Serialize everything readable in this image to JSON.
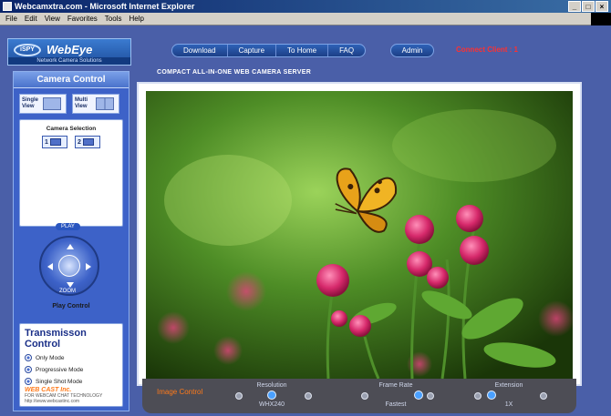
{
  "window": {
    "title": "Webcamxtra.com - Microsoft Internet Explorer",
    "controls": [
      "_",
      "□",
      "×"
    ]
  },
  "menu": [
    "File",
    "Edit",
    "View",
    "Favorites",
    "Tools",
    "Help"
  ],
  "logo": {
    "mark": "iSPY",
    "name": "WebEye",
    "tagline": "Network Camera Solutions"
  },
  "nav": {
    "items": [
      "Download",
      "Capture",
      "To Home",
      "FAQ"
    ],
    "admin": "Admin",
    "connected_clients": "Connect Client : 1"
  },
  "subtitle": "COMPACT ALL-IN-ONE WEB CAMERA SERVER",
  "sidebar": {
    "title": "Camera Control",
    "view_buttons": [
      {
        "label": "Single View",
        "icon": "single-view-icon"
      },
      {
        "label": "Multi View",
        "icon": "multi-view-icon"
      }
    ],
    "camera_selection_label": "Camera Selection",
    "cameras": [
      {
        "label": "1",
        "icon": "camera-icon"
      },
      {
        "label": "2",
        "icon": "camera-icon"
      }
    ],
    "ptz": {
      "top_label": "PLAY",
      "bottom_label": "ZOOM",
      "caption": "Play Control"
    },
    "transmission": {
      "title": "Transmisson Control",
      "options": [
        "Only Mode",
        "Progressive Mode",
        "Single Shot Mode"
      ]
    },
    "vendor": {
      "name": "WEB CAST Inc.",
      "line1": "FOR WEBCAM CHAT TECHNOLOGY",
      "line2": "http://www.webcastinc.com"
    }
  },
  "image_control": {
    "label": "Image Control",
    "groups": [
      {
        "title": "Resolution",
        "value": "WHX240"
      },
      {
        "title": "Frame Rate",
        "value": "Fastest"
      },
      {
        "title": "Extension",
        "value": "1X"
      }
    ]
  },
  "colors": {
    "background": "#4a5fa8",
    "accent_orange": "#ff7a1a",
    "alert_red": "#ff3030",
    "nav_blue": "#2f62b8"
  }
}
